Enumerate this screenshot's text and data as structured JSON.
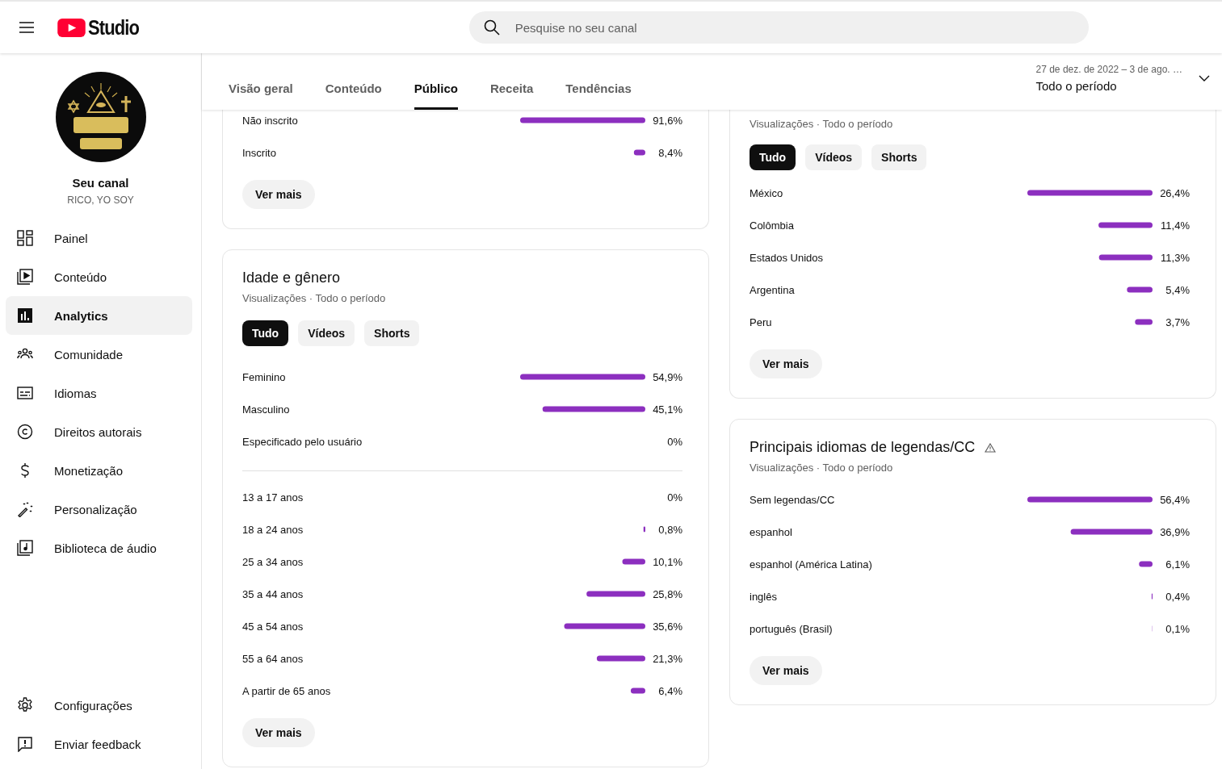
{
  "header": {
    "logo_text": "Studio",
    "search_placeholder": "Pesquise no seu canal"
  },
  "channel": {
    "title": "Seu canal",
    "name": "RICO, YO SOY"
  },
  "sidebar": {
    "items": [
      {
        "label": "Painel",
        "selected": false
      },
      {
        "label": "Conteúdo",
        "selected": false
      },
      {
        "label": "Analytics",
        "selected": true
      },
      {
        "label": "Comunidade",
        "selected": false
      },
      {
        "label": "Idiomas",
        "selected": false
      },
      {
        "label": "Direitos autorais",
        "selected": false
      },
      {
        "label": "Monetização",
        "selected": false
      },
      {
        "label": "Personalização",
        "selected": false
      },
      {
        "label": "Biblioteca de áudio",
        "selected": false
      }
    ],
    "footer_items": [
      {
        "label": "Configurações",
        "selected": false
      },
      {
        "label": "Enviar feedback",
        "selected": false
      }
    ]
  },
  "tabs": [
    {
      "label": "Visão geral",
      "selected": false
    },
    {
      "label": "Conteúdo",
      "selected": false
    },
    {
      "label": "Público",
      "selected": true
    },
    {
      "label": "Receita",
      "selected": false
    },
    {
      "label": "Tendências",
      "selected": false
    }
  ],
  "date_range": {
    "range": "27 de dez. de 2022 – 3 de ago. …",
    "period": "Todo o período"
  },
  "columns": [
    [
      {
        "groups": [
          {
            "chart_data": {
              "type": "bar",
              "orientation": "horizontal",
              "categories": [
                "Não inscrito",
                "Inscrito"
              ],
              "values": [
                91.6,
                8.4
              ],
              "value_labels": [
                "91,6%",
                "8,4%"
              ]
            }
          }
        ],
        "button": "Ver mais"
      },
      {
        "title": "Idade e gênero",
        "subtitle": "Visualizações · Todo o período",
        "filters": [
          {
            "label": "Tudo",
            "selected": true
          },
          {
            "label": "Vídeos",
            "selected": false
          },
          {
            "label": "Shorts",
            "selected": false
          }
        ],
        "groups": [
          {
            "chart_data": {
              "type": "bar",
              "orientation": "horizontal",
              "categories": [
                "Feminino",
                "Masculino",
                "Especificado pelo usuário"
              ],
              "values": [
                54.9,
                45.1,
                0
              ],
              "value_labels": [
                "54,9%",
                "45,1%",
                "0%"
              ]
            }
          },
          {
            "chart_data": {
              "type": "bar",
              "orientation": "horizontal",
              "categories": [
                "13 a 17 anos",
                "18 a 24 anos",
                "25 a 34 anos",
                "35 a 44 anos",
                "45 a 54 anos",
                "55 a 64 anos",
                "A partir de 65 anos"
              ],
              "values": [
                0,
                0.8,
                10.1,
                25.8,
                35.6,
                21.3,
                6.4
              ],
              "value_labels": [
                "0%",
                "0,8%",
                "10,1%",
                "25,8%",
                "35,6%",
                "21,3%",
                "6,4%"
              ]
            }
          }
        ],
        "button": "Ver mais"
      }
    ],
    [
      {
        "subtitle": "Visualizações · Todo o período",
        "filters": [
          {
            "label": "Tudo",
            "selected": true
          },
          {
            "label": "Vídeos",
            "selected": false
          },
          {
            "label": "Shorts",
            "selected": false
          }
        ],
        "groups": [
          {
            "chart_data": {
              "type": "bar",
              "orientation": "horizontal",
              "categories": [
                "México",
                "Colômbia",
                "Estados Unidos",
                "Argentina",
                "Peru"
              ],
              "values": [
                26.4,
                11.4,
                11.3,
                5.4,
                3.7
              ],
              "value_labels": [
                "26,4%",
                "11,4%",
                "11,3%",
                "5,4%",
                "3,7%"
              ]
            }
          }
        ],
        "button": "Ver mais"
      },
      {
        "title": "Principais idiomas de legendas/CC",
        "warning": true,
        "subtitle": "Visualizações · Todo o período",
        "groups": [
          {
            "chart_data": {
              "type": "bar",
              "orientation": "horizontal",
              "categories": [
                "Sem legendas/CC",
                "espanhol",
                "espanhol (América Latina)",
                "inglês",
                "português (Brasil)"
              ],
              "values": [
                56.4,
                36.9,
                6.1,
                0.4,
                0.1
              ],
              "value_labels": [
                "56,4%",
                "36,9%",
                "6,1%",
                "0,4%",
                "0,1%"
              ]
            }
          }
        ],
        "button": "Ver mais"
      }
    ]
  ]
}
